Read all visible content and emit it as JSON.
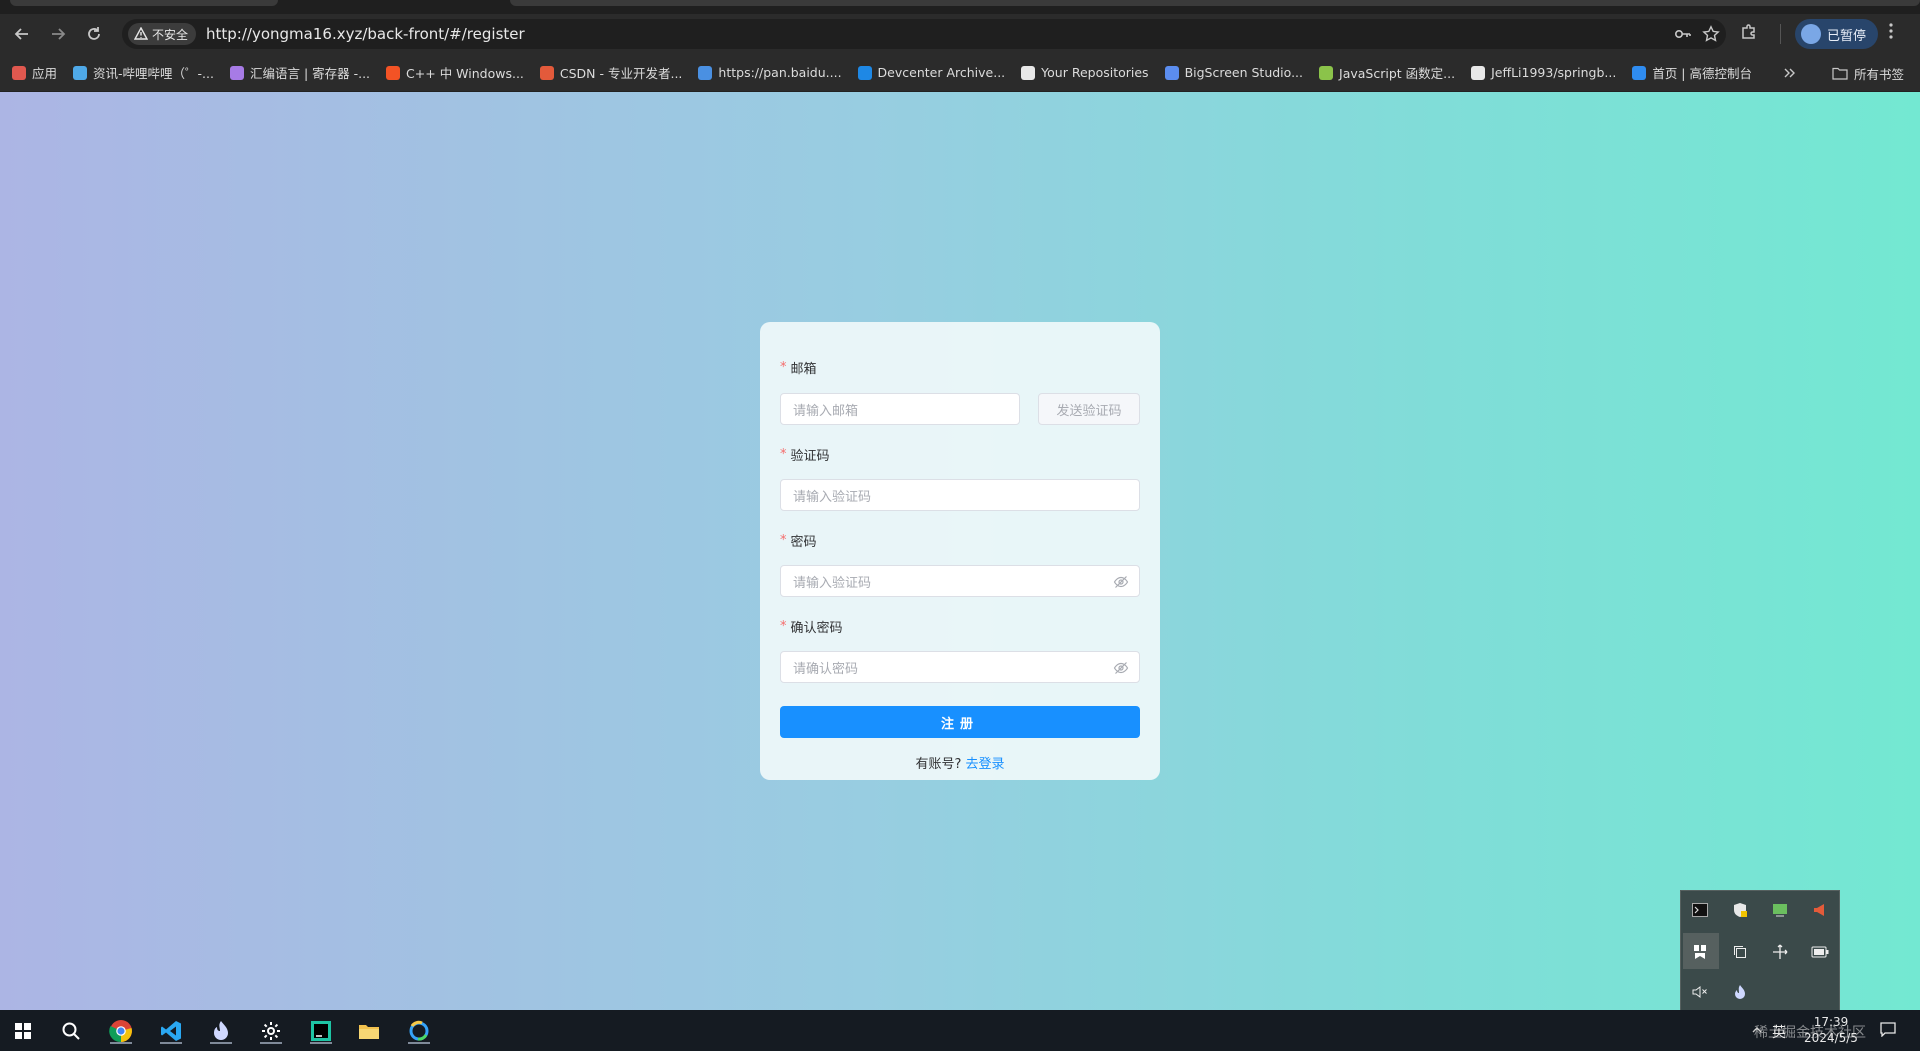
{
  "browser": {
    "security_label": "不安全",
    "url": "http://yongma16.xyz/back-front/#/register",
    "profile_label": "已暂停"
  },
  "bookmarks": [
    {
      "label": "应用",
      "icon": "apps-grid-icon",
      "color": "#e0584f"
    },
    {
      "label": "资讯-哔哩哔哩（゜-...",
      "icon": "bilibili-icon",
      "color": "#4fa9e8"
    },
    {
      "label": "汇编语言 | 寄存器 -...",
      "icon": "visualstudio-icon",
      "color": "#a77be6"
    },
    {
      "label": "C++ 中 Windows...",
      "icon": "windows-icon",
      "color": "#f35325"
    },
    {
      "label": "CSDN - 专业开发者...",
      "icon": "csdn-icon",
      "color": "#e35a3b"
    },
    {
      "label": "https://pan.baidu....",
      "icon": "baidu-pan-icon",
      "color": "#4a90e2"
    },
    {
      "label": "Devcenter Archive...",
      "icon": "devcenter-icon",
      "color": "#1e88e5"
    },
    {
      "label": "Your Repositories",
      "icon": "github-icon",
      "color": "#e8e8e8"
    },
    {
      "label": "BigScreen Studio...",
      "icon": "bigscreen-icon",
      "color": "#5b8def"
    },
    {
      "label": "JavaScript 函数定...",
      "icon": "js-site-icon",
      "color": "#8bc34a"
    },
    {
      "label": "JeffLi1993/springb...",
      "icon": "github-icon",
      "color": "#e8e8e8"
    },
    {
      "label": "首页 | 高德控制台",
      "icon": "amap-icon",
      "color": "#2f8cf0"
    }
  ],
  "bookmarks_all": "所有书签",
  "form": {
    "email_label": "邮箱",
    "email_placeholder": "请输入邮箱",
    "send_code_label": "发送验证码",
    "code_label": "验证码",
    "code_placeholder": "请输入验证码",
    "password_label": "密码",
    "password_placeholder": "请输入验证码",
    "confirm_label": "确认密码",
    "confirm_placeholder": "请确认密码",
    "required_mark": "*",
    "submit_label": "注册",
    "has_account_text": "有账号?",
    "login_link_label": "去登录"
  },
  "taskbar": {
    "ime": "英",
    "time": "17:39",
    "date": "2024/5/5",
    "watermark": "稀土掘金技术社区"
  },
  "colors": {
    "primary": "#1890ff",
    "required": "#f56c6c"
  }
}
